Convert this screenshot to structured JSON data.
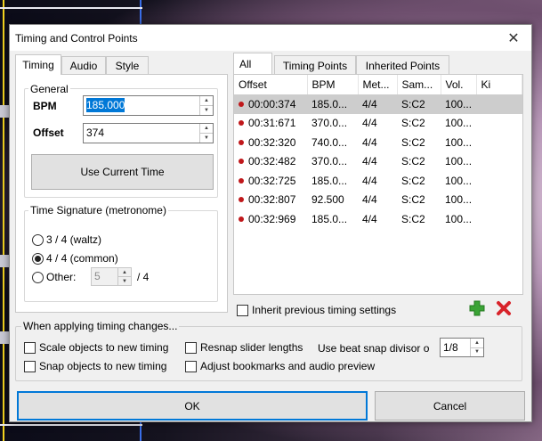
{
  "window": {
    "title": "Timing and Control Points",
    "close_glyph": "✕"
  },
  "left_tabs": [
    {
      "label": "Timing",
      "active": true
    },
    {
      "label": "Audio",
      "active": false
    },
    {
      "label": "Style",
      "active": false
    }
  ],
  "general": {
    "group_label": "General",
    "bpm_label": "BPM",
    "bpm_value": "185.000",
    "offset_label": "Offset",
    "offset_value": "374",
    "use_current_time_label": "Use Current Time"
  },
  "time_signature": {
    "group_label": "Time Signature (metronome)",
    "options": [
      {
        "label": "3 / 4 (waltz)",
        "selected": false
      },
      {
        "label": "4 / 4 (common)",
        "selected": true
      },
      {
        "label": "Other:",
        "selected": false
      }
    ],
    "other_value": "5",
    "other_suffix": "/ 4"
  },
  "right_tabs": [
    {
      "label": "All",
      "active": true
    },
    {
      "label": "Timing Points",
      "active": false
    },
    {
      "label": "Inherited Points",
      "active": false
    }
  ],
  "points_table": {
    "columns": [
      "Offset",
      "BPM",
      "Met...",
      "Sam...",
      "Vol.",
      "Ki"
    ],
    "rows": [
      {
        "offset": "00:00:374",
        "bpm": "185.0...",
        "meter": "4/4",
        "sample": "S:C2",
        "volume": "100...",
        "selected": true
      },
      {
        "offset": "00:31:671",
        "bpm": "370.0...",
        "meter": "4/4",
        "sample": "S:C2",
        "volume": "100...",
        "selected": false
      },
      {
        "offset": "00:32:320",
        "bpm": "740.0...",
        "meter": "4/4",
        "sample": "S:C2",
        "volume": "100...",
        "selected": false
      },
      {
        "offset": "00:32:482",
        "bpm": "370.0...",
        "meter": "4/4",
        "sample": "S:C2",
        "volume": "100...",
        "selected": false
      },
      {
        "offset": "00:32:725",
        "bpm": "185.0...",
        "meter": "4/4",
        "sample": "S:C2",
        "volume": "100...",
        "selected": false
      },
      {
        "offset": "00:32:807",
        "bpm": "92.500",
        "meter": "4/4",
        "sample": "S:C2",
        "volume": "100...",
        "selected": false
      },
      {
        "offset": "00:32:969",
        "bpm": "185.0...",
        "meter": "4/4",
        "sample": "S:C2",
        "volume": "100...",
        "selected": false
      }
    ]
  },
  "inherit_label": "Inherit previous timing settings",
  "add_icon": "plus-icon",
  "remove_icon": "x-icon",
  "applying": {
    "group_label": "When applying timing changes...",
    "scale_objects": "Scale objects to new timing",
    "resnap_sliders": "Resnap slider lengths",
    "beat_snap_label": "Use beat snap divisor o",
    "beat_snap_value": "1/8",
    "snap_objects": "Snap objects to new timing",
    "adjust_bookmarks": "Adjust bookmarks and audio preview"
  },
  "buttons": {
    "ok": "OK",
    "cancel": "Cancel"
  },
  "colors": {
    "accent": "#0078d7",
    "point_dot": "#c0181b",
    "add_green": "#3aa335",
    "remove_red": "#d8232a"
  }
}
